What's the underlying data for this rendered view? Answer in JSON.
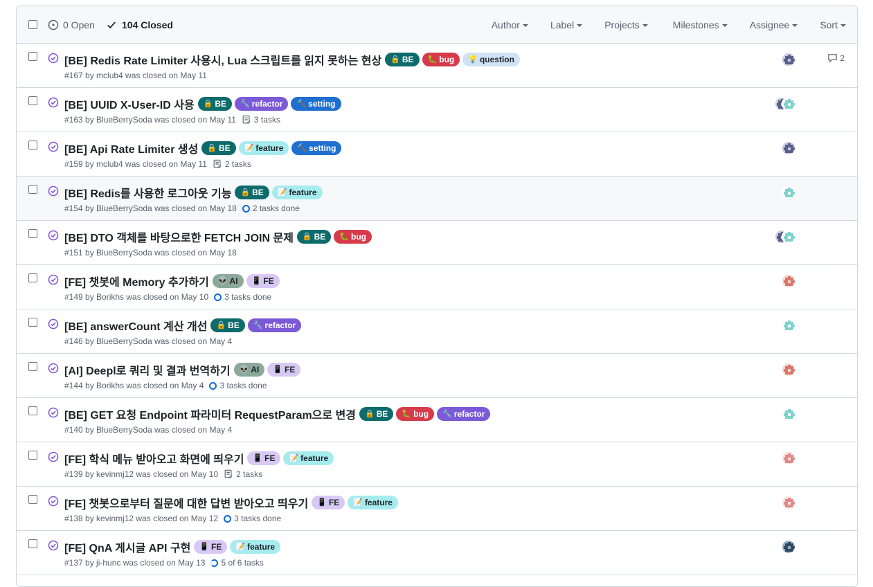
{
  "header": {
    "open_label": "0 Open",
    "closed_label": "104 Closed",
    "filters": [
      "Author",
      "Label",
      "Projects",
      "Milestones",
      "Assignee",
      "Sort"
    ]
  },
  "issues": [
    {
      "title": "[BE] Redis Rate Limiter 사용시, Lua 스크립트를 읽지 못하는 현상",
      "labels": [
        {
          "text": "BE",
          "icon": "🔒",
          "bg": "#0e6b6b",
          "fg": "#ffffff"
        },
        {
          "text": "bug",
          "icon": "🐛",
          "bg": "#d73a4a",
          "fg": "#ffffff"
        },
        {
          "text": "question",
          "icon": "💡",
          "bg": "#cfe3f5",
          "fg": "#1f2328"
        }
      ],
      "meta": "#167 by mclub4 was closed on May 11",
      "tasks": "",
      "task_icon": "",
      "assignees": [
        "avatar-purple"
      ],
      "comments": "2"
    },
    {
      "title": "[BE] UUID X-User-ID 사용",
      "labels": [
        {
          "text": "BE",
          "icon": "🔒",
          "bg": "#0e6b6b",
          "fg": "#ffffff"
        },
        {
          "text": "refactor",
          "icon": "🔧",
          "bg": "#7b5ad8",
          "fg": "#ffffff"
        },
        {
          "text": "setting",
          "icon": "🔨",
          "bg": "#1f6fd0",
          "fg": "#ffffff"
        }
      ],
      "meta": "#163 by BlueBerrySoda was closed on May 11",
      "tasks": "3 tasks",
      "task_icon": "list",
      "assignees": [
        "avatar-purple",
        "avatar-teal"
      ],
      "comments": ""
    },
    {
      "title": "[BE] Api Rate Limiter 생성",
      "labels": [
        {
          "text": "BE",
          "icon": "🔒",
          "bg": "#0e6b6b",
          "fg": "#ffffff"
        },
        {
          "text": "feature",
          "icon": "📝",
          "bg": "#a6ecee",
          "fg": "#1f2328"
        },
        {
          "text": "setting",
          "icon": "🔨",
          "bg": "#1f6fd0",
          "fg": "#ffffff"
        }
      ],
      "meta": "#159 by mclub4 was closed on May 11",
      "tasks": "2 tasks",
      "task_icon": "list",
      "assignees": [
        "avatar-purple"
      ],
      "comments": ""
    },
    {
      "title": "[BE] Redis를 사용한 로그아웃 기능",
      "labels": [
        {
          "text": "BE",
          "icon": "🔒",
          "bg": "#0e6b6b",
          "fg": "#ffffff"
        },
        {
          "text": "feature",
          "icon": "📝",
          "bg": "#a6ecee",
          "fg": "#1f2328"
        }
      ],
      "meta": "#154 by BlueBerrySoda was closed on May 18",
      "tasks": "2 tasks done",
      "task_icon": "ring",
      "assignees": [
        "avatar-teal"
      ],
      "comments": "",
      "highlight": true
    },
    {
      "title": "[BE] DTO 객체를 바탕으로한 FETCH JOIN 문제",
      "labels": [
        {
          "text": "BE",
          "icon": "🔒",
          "bg": "#0e6b6b",
          "fg": "#ffffff"
        },
        {
          "text": "bug",
          "icon": "🐛",
          "bg": "#d73a4a",
          "fg": "#ffffff"
        }
      ],
      "meta": "#151 by BlueBerrySoda was closed on May 18",
      "tasks": "",
      "task_icon": "",
      "assignees": [
        "avatar-purple",
        "avatar-teal"
      ],
      "comments": ""
    },
    {
      "title": "[FE] 챗봇에 Memory 추가하기",
      "labels": [
        {
          "text": "AI",
          "icon": "👽",
          "bg": "#8aa99a",
          "fg": "#1f2328"
        },
        {
          "text": "FE",
          "icon": "📱",
          "bg": "#d8c8f4",
          "fg": "#1f2328"
        }
      ],
      "meta": "#149 by Borikhs was closed on May 10",
      "tasks": "3 tasks done",
      "task_icon": "ring",
      "assignees": [
        "avatar-red"
      ],
      "comments": ""
    },
    {
      "title": "[BE] answerCount 계산 개선",
      "labels": [
        {
          "text": "BE",
          "icon": "🔒",
          "bg": "#0e6b6b",
          "fg": "#ffffff"
        },
        {
          "text": "refactor",
          "icon": "🔧",
          "bg": "#7b5ad8",
          "fg": "#ffffff"
        }
      ],
      "meta": "#146 by BlueBerrySoda was closed on May 4",
      "tasks": "",
      "task_icon": "",
      "assignees": [
        "avatar-teal"
      ],
      "comments": ""
    },
    {
      "title": "[AI] Deepl로 쿼리 및 결과 번역하기",
      "labels": [
        {
          "text": "AI",
          "icon": "👽",
          "bg": "#8aa99a",
          "fg": "#1f2328"
        },
        {
          "text": "FE",
          "icon": "📱",
          "bg": "#d8c8f4",
          "fg": "#1f2328"
        }
      ],
      "meta": "#144 by Borikhs was closed on May 4",
      "tasks": "3 tasks done",
      "task_icon": "ring",
      "assignees": [
        "avatar-red"
      ],
      "comments": ""
    },
    {
      "title": "[BE] GET 요청 Endpoint 파라미터 RequestParam으로 변경",
      "labels": [
        {
          "text": "BE",
          "icon": "🔒",
          "bg": "#0e6b6b",
          "fg": "#ffffff"
        },
        {
          "text": "bug",
          "icon": "🐛",
          "bg": "#d73a4a",
          "fg": "#ffffff"
        },
        {
          "text": "refactor",
          "icon": "🔧",
          "bg": "#7b5ad8",
          "fg": "#ffffff"
        }
      ],
      "meta": "#140 by BlueBerrySoda was closed on May 4",
      "tasks": "",
      "task_icon": "",
      "assignees": [
        "avatar-teal"
      ],
      "comments": ""
    },
    {
      "title": "[FE] 학식 메뉴 받아오고 화면에 띄우기",
      "labels": [
        {
          "text": "FE",
          "icon": "📱",
          "bg": "#d8c8f4",
          "fg": "#1f2328"
        },
        {
          "text": "feature",
          "icon": "📝",
          "bg": "#a6ecee",
          "fg": "#1f2328"
        }
      ],
      "meta": "#139 by kevinmj12 was closed on May 10",
      "tasks": "2 tasks",
      "task_icon": "list",
      "assignees": [
        "avatar-pink"
      ],
      "comments": ""
    },
    {
      "title": "[FE] 챗봇으로부터 질문에 대한 답변 받아오고 띄우기",
      "labels": [
        {
          "text": "FE",
          "icon": "📱",
          "bg": "#d8c8f4",
          "fg": "#1f2328"
        },
        {
          "text": "feature",
          "icon": "📝",
          "bg": "#a6ecee",
          "fg": "#1f2328"
        }
      ],
      "meta": "#138 by kevinmj12 was closed on May 12",
      "tasks": "3 tasks done",
      "task_icon": "ring",
      "assignees": [
        "avatar-pink"
      ],
      "comments": ""
    },
    {
      "title": "[FE] QnA 게시글 API 구현",
      "labels": [
        {
          "text": "FE",
          "icon": "📱",
          "bg": "#d8c8f4",
          "fg": "#1f2328"
        },
        {
          "text": "feature",
          "icon": "📝",
          "bg": "#a6ecee",
          "fg": "#1f2328"
        }
      ],
      "meta": "#137 by ji-hunc was closed on May 13",
      "tasks": "5 of 6 tasks",
      "task_icon": "partial",
      "assignees": [
        "avatar-photo"
      ],
      "comments": ""
    }
  ]
}
